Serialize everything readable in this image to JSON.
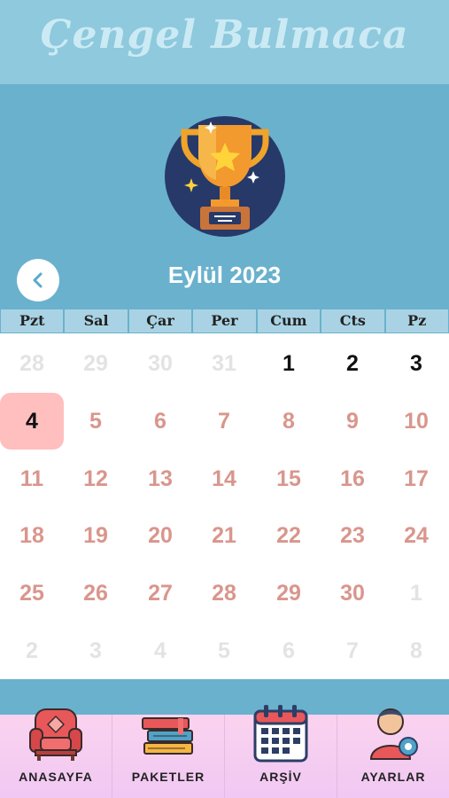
{
  "app": {
    "title": "Çengel Bulmaca"
  },
  "calendar": {
    "month_label": "Eylül 2023",
    "weekdays": [
      "Pzt",
      "Sal",
      "Çar",
      "Per",
      "Cum",
      "Cts",
      "Pz"
    ],
    "weeks": [
      [
        "28",
        "29",
        "30",
        "31",
        "1",
        "2",
        "3"
      ],
      [
        "4",
        "5",
        "6",
        "7",
        "8",
        "9",
        "10"
      ],
      [
        "11",
        "12",
        "13",
        "14",
        "15",
        "16",
        "17"
      ],
      [
        "18",
        "19",
        "20",
        "21",
        "22",
        "23",
        "24"
      ],
      [
        "25",
        "26",
        "27",
        "28",
        "29",
        "30",
        "1"
      ],
      [
        "2",
        "3",
        "4",
        "5",
        "6",
        "7",
        "8"
      ]
    ],
    "today": "4"
  },
  "nav": {
    "items": [
      {
        "label": "ANASAYFA",
        "icon": "armchair-icon"
      },
      {
        "label": "PAKETLER",
        "icon": "books-icon"
      },
      {
        "label": "ARŞİV",
        "icon": "calendar-icon"
      },
      {
        "label": "AYARLAR",
        "icon": "user-settings-icon"
      }
    ]
  },
  "colors": {
    "header": "#8ec9de",
    "hero": "#6ab1cd",
    "past_day": "#d9968d",
    "today_bg": "#ffbfbf",
    "nav_bg": "#f4c8ee"
  }
}
